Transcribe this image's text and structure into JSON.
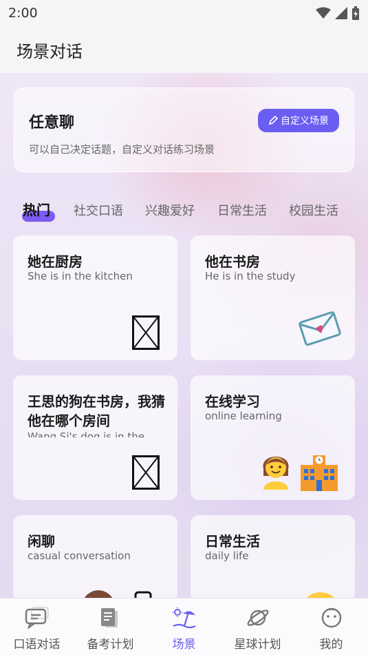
{
  "status_bar": {
    "time": "2:00"
  },
  "header": {
    "title": "场景对话"
  },
  "banner": {
    "title": "任意聊",
    "subtitle": "可以自己决定话题，自定义对话练习场景",
    "button_label": "自定义场景"
  },
  "tabs": [
    "热门",
    "社交口语",
    "兴趣爱好",
    "日常生活",
    "校园生活"
  ],
  "cards": [
    {
      "title": "她在厨房",
      "subtitle": "She is in the kitchen"
    },
    {
      "title": "他在书房",
      "subtitle": "He is in the study"
    },
    {
      "title": "王思的狗在书房，我猜他在哪个房间",
      "subtitle": "Wang Si's dog is in the"
    },
    {
      "title": "在线学习",
      "subtitle": "online learning"
    },
    {
      "title": "闲聊",
      "subtitle": "casual conversation"
    },
    {
      "title": "日常生活",
      "subtitle": "daily life"
    }
  ],
  "bottom_nav": [
    {
      "label": "口语对话",
      "icon": "chat-icon"
    },
    {
      "label": "备考计划",
      "icon": "document-icon"
    },
    {
      "label": "场景",
      "icon": "beach-icon",
      "active": true
    },
    {
      "label": "星球计划",
      "icon": "planet-icon"
    },
    {
      "label": "我的",
      "icon": "profile-face-icon"
    }
  ],
  "colors": {
    "accent": "#6a5ef2",
    "tab_underline": "#7c5cf0"
  }
}
